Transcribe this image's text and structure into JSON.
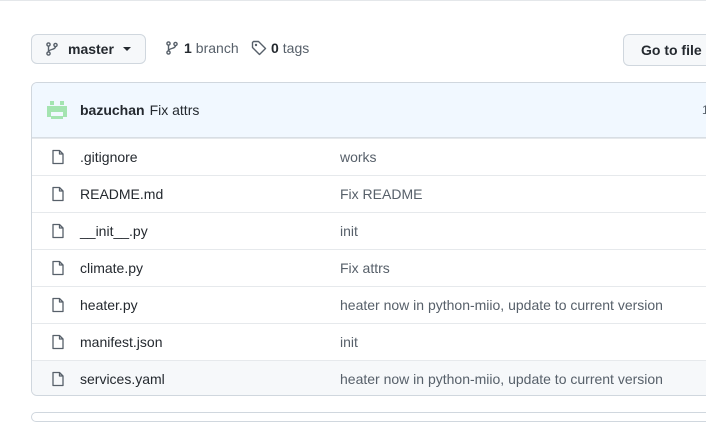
{
  "toolbar": {
    "branch_name": "master",
    "branch_count": "1",
    "branch_label": "branch",
    "tag_count": "0",
    "tag_label": "tags",
    "goto_file": "Go to file"
  },
  "latest_commit": {
    "author": "bazuchan",
    "message": "Fix attrs",
    "partial": "1"
  },
  "files": [
    {
      "name": ".gitignore",
      "commit": "works"
    },
    {
      "name": "README.md",
      "commit": "Fix README"
    },
    {
      "name": "__init__.py",
      "commit": "init"
    },
    {
      "name": "climate.py",
      "commit": "Fix attrs"
    },
    {
      "name": "heater.py",
      "commit": "heater now in python-miio, update to current version"
    },
    {
      "name": "manifest.json",
      "commit": "init"
    },
    {
      "name": "services.yaml",
      "commit": "heater now in python-miio, update to current version"
    }
  ],
  "colors": {
    "accent_bg": "#f1f8ff",
    "avatar_green": "#a4e4b1"
  }
}
